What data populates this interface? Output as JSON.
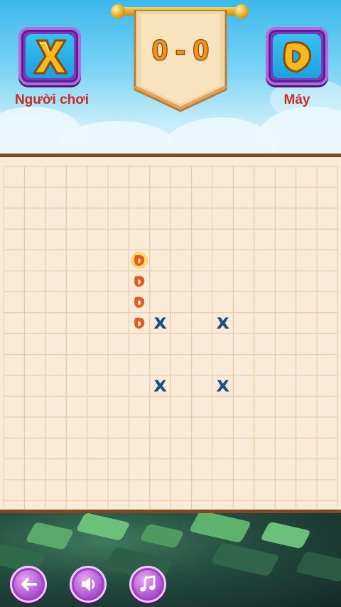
{
  "header": {
    "score": "0 - 0",
    "player": {
      "label": "Người chơi",
      "symbol": "X"
    },
    "computer": {
      "label": "Máy",
      "symbol": "O"
    }
  },
  "board": {
    "columns": 16,
    "rows": 17,
    "pieces": [
      {
        "col": 6,
        "row": 4,
        "symbol": "O",
        "highlight": true
      },
      {
        "col": 6,
        "row": 5,
        "symbol": "O"
      },
      {
        "col": 6,
        "row": 6,
        "symbol": "O"
      },
      {
        "col": 6,
        "row": 7,
        "symbol": "O"
      },
      {
        "col": 7,
        "row": 7,
        "symbol": "X"
      },
      {
        "col": 10,
        "row": 7,
        "symbol": "X"
      },
      {
        "col": 7,
        "row": 10,
        "symbol": "X"
      },
      {
        "col": 10,
        "row": 10,
        "symbol": "X"
      }
    ]
  },
  "footer": {
    "buttons": [
      {
        "name": "back",
        "icon": "arrow-left-icon"
      },
      {
        "name": "sound",
        "icon": "speaker-icon"
      },
      {
        "name": "music",
        "icon": "music-note-icon"
      }
    ]
  },
  "colors": {
    "x_piece": "#1f4f7a",
    "o_piece": "#e8591a",
    "grid_line": "#e8c9a7",
    "accent_purple": "#9a44c3",
    "label_red": "#d02a1f"
  }
}
